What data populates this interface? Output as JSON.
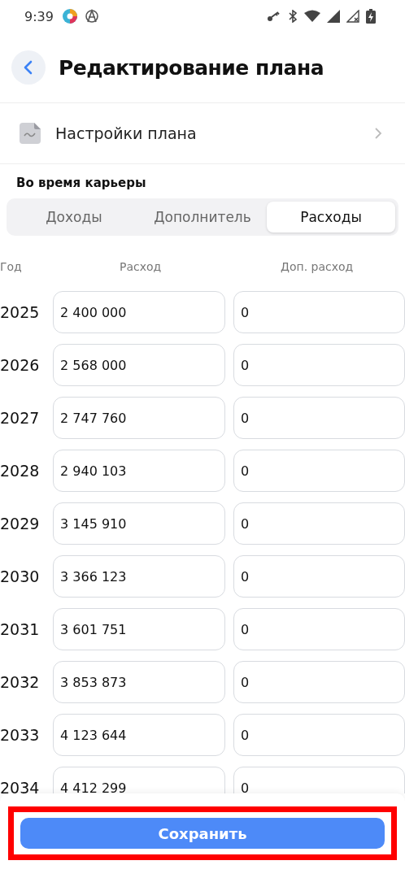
{
  "status_bar": {
    "time": "9:39"
  },
  "header": {
    "title": "Редактирование плана"
  },
  "settings_row": {
    "label": "Настройки плана"
  },
  "section": {
    "title": "Во время карьеры"
  },
  "tabs": [
    {
      "label": "Доходы",
      "selected": false
    },
    {
      "label": "Дополнитель",
      "selected": false
    },
    {
      "label": "Расходы",
      "selected": true
    }
  ],
  "table": {
    "columns": [
      "Год",
      "Расход",
      "Доп. расход"
    ],
    "rows": [
      {
        "year": "2025",
        "expense": "2 400 000",
        "extra": "0"
      },
      {
        "year": "2026",
        "expense": "2 568 000",
        "extra": "0"
      },
      {
        "year": "2027",
        "expense": "2 747 760",
        "extra": "0"
      },
      {
        "year": "2028",
        "expense": "2 940 103",
        "extra": "0"
      },
      {
        "year": "2029",
        "expense": "3 145 910",
        "extra": "0"
      },
      {
        "year": "2030",
        "expense": "3 366 123",
        "extra": "0"
      },
      {
        "year": "2031",
        "expense": "3 601 751",
        "extra": "0"
      },
      {
        "year": "2032",
        "expense": "3 853 873",
        "extra": "0"
      },
      {
        "year": "2033",
        "expense": "4 123 644",
        "extra": "0"
      },
      {
        "year": "2034",
        "expense": "4 412 299",
        "extra": "0"
      }
    ]
  },
  "save_button": {
    "label": "Сохранить",
    "highlighted": true
  }
}
